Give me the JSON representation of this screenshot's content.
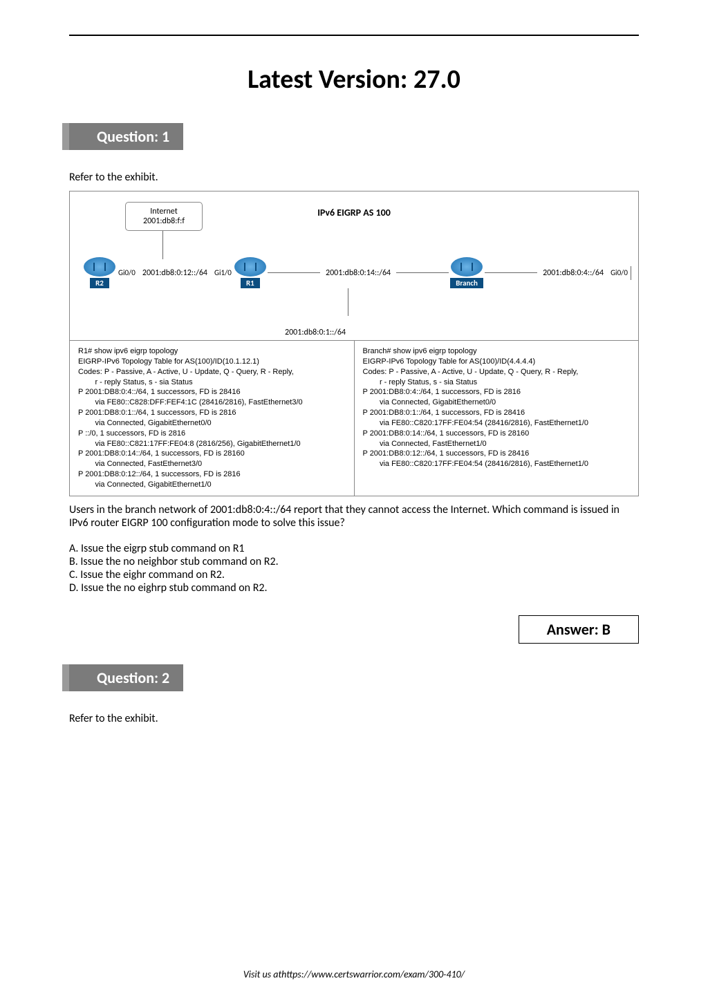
{
  "page": {
    "version_title": "Latest Version: 27.0",
    "footer": "Visit us athttps://www.certswarrior.com/exam/300-410/"
  },
  "q1": {
    "header": "Question: 1",
    "intro": "Refer to the exhibit.",
    "exhibit": {
      "internet_label": "Internet",
      "internet_addr": "2001:db8:f:f",
      "as_title": "IPv6 EIGRP AS 100",
      "net_r2_r1": "2001:db8:0:12::/64",
      "net_r1_branch": "2001:db8:0:14::/64",
      "net_branch_right": "2001:db8:0:4::/64",
      "net_below_r1": "2001:db8:0:1::/64",
      "r2": {
        "label": "R2",
        "if_right": "Gi0/0"
      },
      "r1": {
        "label": "R1",
        "if_left": "Gi1/0"
      },
      "branch": {
        "label": "Branch",
        "if_right": "Gi0/0"
      }
    },
    "cli_left": [
      "R1# show ipv6 eigrp topology",
      "EIGRP-IPv6 Topology Table for AS(100)/ID(10.1.12.1)",
      "Codes: P - Passive, A - Active, U - Update, Q - Query, R - Reply,",
      "        r - reply Status, s - sia Status",
      "P 2001:DB8:0:4::/64, 1 successors, FD is 28416",
      "        via FE80::C828:DFF:FEF4:1C (28416/2816), FastEthernet3/0",
      "P 2001:DB8:0:1::/64, 1 successors, FD is 2816",
      "        via Connected, GigabitEthernet0/0",
      "P ::/0, 1 successors, FD is 2816",
      "        via FE80::C821:17FF:FE04:8 (2816/256), GigabitEthernet1/0",
      "P 2001:DB8:0:14::/64, 1 successors, FD is 28160",
      "        via Connected, FastEthernet3/0",
      "P 2001:DB8:0:12::/64, 1 successors, FD is 2816",
      "        via Connected, GigabitEthernet1/0"
    ],
    "cli_right": [
      "Branch# show ipv6 eigrp topology",
      "EIGRP-IPv6 Topology Table for AS(100)/ID(4.4.4.4)",
      "Codes: P - Passive, A - Active, U - Update, Q - Query, R - Reply,",
      "        r - reply Status, s - sia Status",
      "P 2001:DB8:0:4::/64, 1 successors, FD is 2816",
      "        via Connected, GigabitEthernet0/0",
      "P 2001:DB8:0:1::/64, 1 successors, FD is 28416",
      "        via FE80::C820:17FF:FE04:54 (28416/2816), FastEthernet1/0",
      "P 2001:DB8:0:14::/64, 1 successors, FD is 28160",
      "        via Connected, FastEthernet1/0",
      "P 2001:DB8:0:12::/64, 1 successors, FD is 28416",
      "        via FE80::C820:17FF:FE04:54 (28416/2816), FastEthernet1/0"
    ],
    "question_text": "Users in the branch network of 2001:db8:0:4::/64 report that they cannot access the Internet. Which command is issued in IPv6 router EIGRP 100 configuration mode to solve this issue?",
    "options": {
      "a": "A. Issue the eigrp stub command on R1",
      "b": "B. Issue the no neighbor stub command on R2.",
      "c": "C. Issue the eighr command on R2.",
      "d": "D. Issue the no eighrp stub command on R2."
    },
    "answer": "Answer: B"
  },
  "q2": {
    "header": "Question: 2",
    "intro": "Refer to the exhibit."
  }
}
